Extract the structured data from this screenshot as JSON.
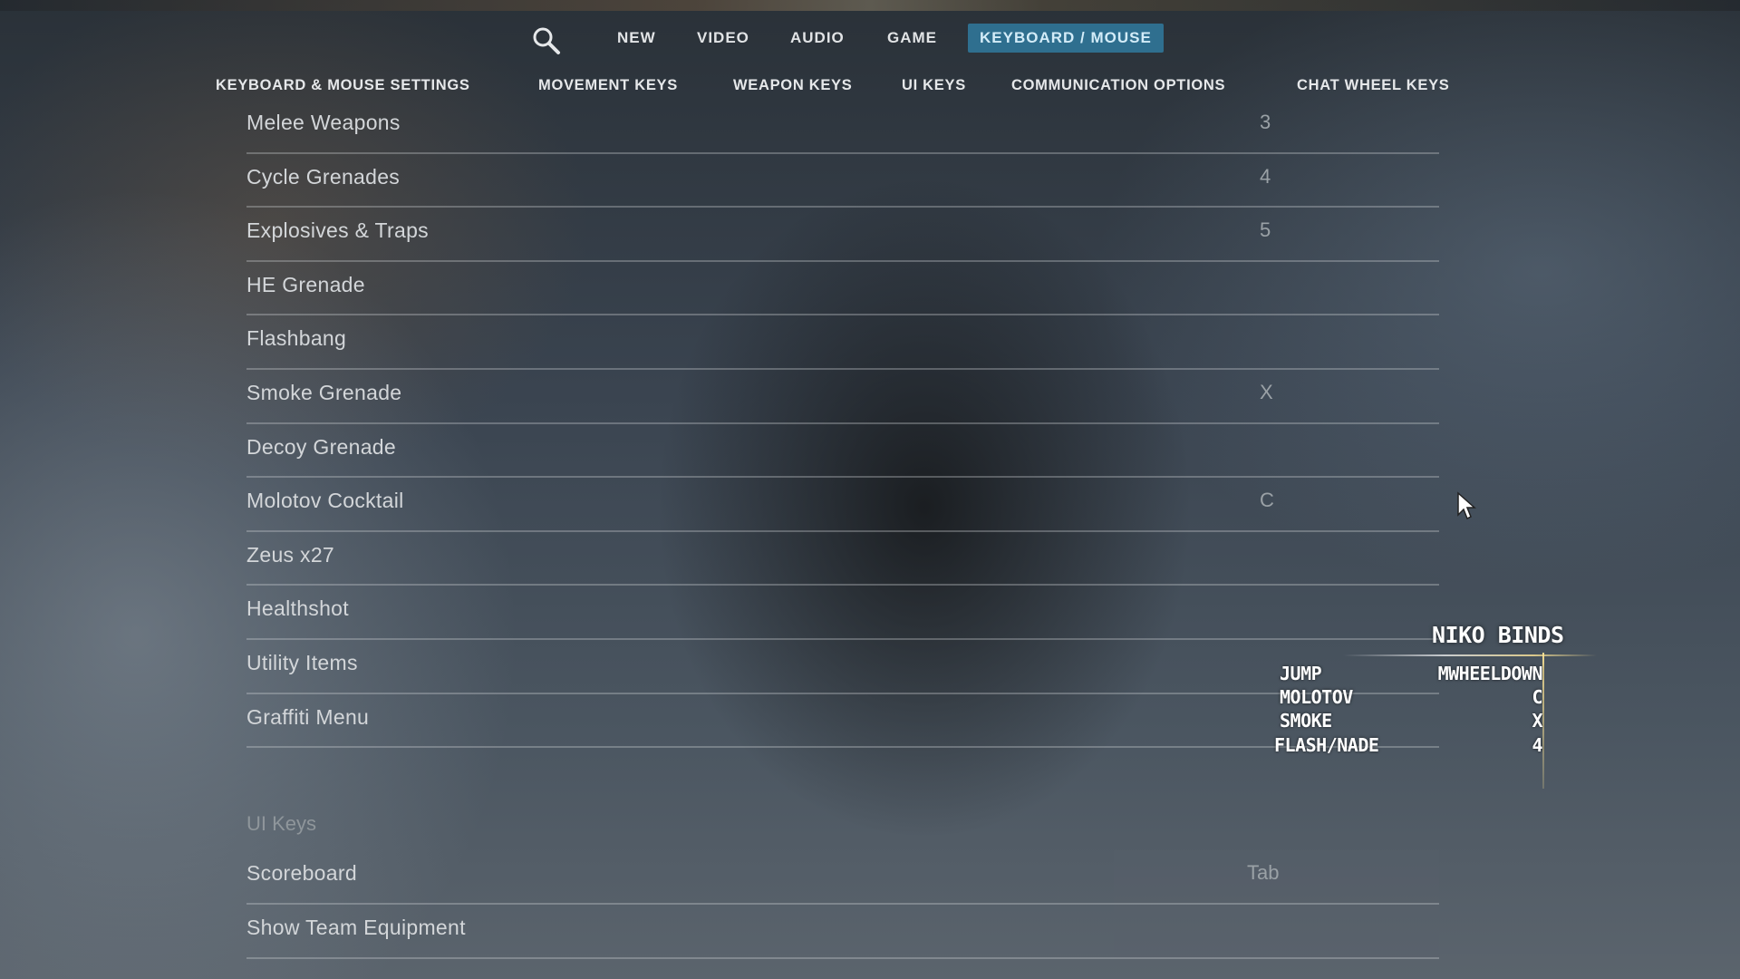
{
  "top_nav": {
    "search_icon": "search-icon",
    "tabs": [
      {
        "label": "NEW"
      },
      {
        "label": "VIDEO"
      },
      {
        "label": "AUDIO"
      },
      {
        "label": "GAME"
      },
      {
        "label": "KEYBOARD / MOUSE",
        "active": true
      }
    ]
  },
  "sub_nav": {
    "items": [
      {
        "label": "KEYBOARD & MOUSE SETTINGS"
      },
      {
        "label": "MOVEMENT KEYS"
      },
      {
        "label": "WEAPON KEYS"
      },
      {
        "label": "UI KEYS"
      },
      {
        "label": "COMMUNICATION OPTIONS"
      },
      {
        "label": "CHAT WHEEL KEYS"
      }
    ]
  },
  "weapon_keys": [
    {
      "action": "Melee Weapons",
      "key": "3"
    },
    {
      "action": "Cycle Grenades",
      "key": "4"
    },
    {
      "action": "Explosives & Traps",
      "key": "5"
    },
    {
      "action": "HE Grenade",
      "key": ""
    },
    {
      "action": "Flashbang",
      "key": ""
    },
    {
      "action": "Smoke Grenade",
      "key": "X"
    },
    {
      "action": "Decoy Grenade",
      "key": ""
    },
    {
      "action": "Molotov Cocktail",
      "key": "C"
    },
    {
      "action": "Zeus x27",
      "key": ""
    },
    {
      "action": "Healthshot",
      "key": ""
    },
    {
      "action": "Utility Items",
      "key": ""
    },
    {
      "action": "Graffiti Menu",
      "key": ""
    }
  ],
  "ui_keys": {
    "section_title": "UI Keys",
    "rows": [
      {
        "action": "Scoreboard",
        "key": "Tab"
      },
      {
        "action": "Show Team Equipment",
        "key": ""
      }
    ]
  },
  "overlay": {
    "title": "NIKO BINDS",
    "binds": [
      {
        "action": "JUMP",
        "value": "MWHEELDOWN"
      },
      {
        "action": "MOLOTOV",
        "value": "C"
      },
      {
        "action": "SMOKE",
        "value": "X"
      },
      {
        "action": "FLASH/NADE",
        "value": "4"
      }
    ]
  },
  "colors": {
    "active_tab_bg": "#2f6f8f",
    "active_tab_text": "#d3ecf8",
    "overlay_accent": "#ffe696"
  }
}
